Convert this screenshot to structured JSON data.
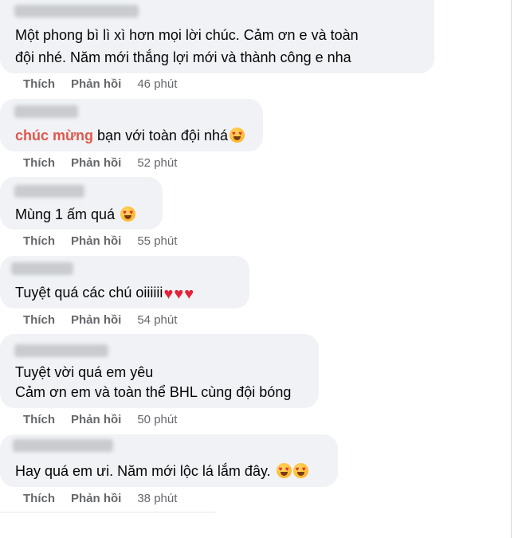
{
  "actions": {
    "like_label": "Thích",
    "reply_label": "Phản hồi"
  },
  "comments": [
    {
      "text_lines": [
        "Một phong bì lì xì hơn mọi lời chúc. Cảm ơn e và toàn",
        "đội nhé. Năm mới thắng lợi mới và thành công e nha"
      ],
      "time": "46 phút"
    },
    {
      "highlight": "chúc mừng",
      "text": " bạn với toàn đội nhá",
      "time": "52 phút"
    },
    {
      "text": "Mùng 1 ấm quá ",
      "time": "55 phút"
    },
    {
      "text": "Tuyệt quá các chú oiiiiii",
      "time": "54 phút"
    },
    {
      "text_lines": [
        "Tuyệt vời quá em yêu",
        "Cảm ơn em và toàn thể BHL cùng đội bóng"
      ],
      "time": "50 phút"
    },
    {
      "text": "Hay quá em ưi. Năm mới lộc lá lắm đây. ",
      "time": "38 phút"
    }
  ],
  "icons": {
    "heart_eyes": "smiling-face-with-heart-eyes",
    "heart": "red-heart"
  },
  "colors": {
    "bubble": "#f0f2f5",
    "highlight": "#e0584b",
    "meta_text": "#65676b"
  }
}
